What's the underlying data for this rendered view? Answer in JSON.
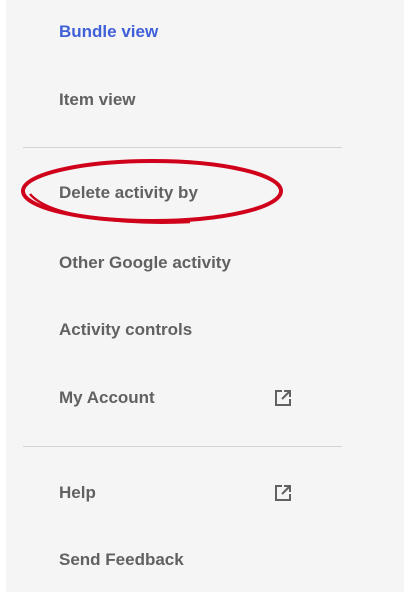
{
  "menu": {
    "bundle_view": "Bundle view",
    "item_view": "Item view",
    "delete_activity_by": "Delete activity by",
    "other_google_activity": "Other Google activity",
    "activity_controls": "Activity controls",
    "my_account": "My Account",
    "help": "Help",
    "send_feedback": "Send Feedback"
  },
  "icons": {
    "external_link": "open-in-new-icon"
  },
  "colors": {
    "active_text": "#4060d8",
    "text": "#616161",
    "annotation": "#d0021b"
  }
}
